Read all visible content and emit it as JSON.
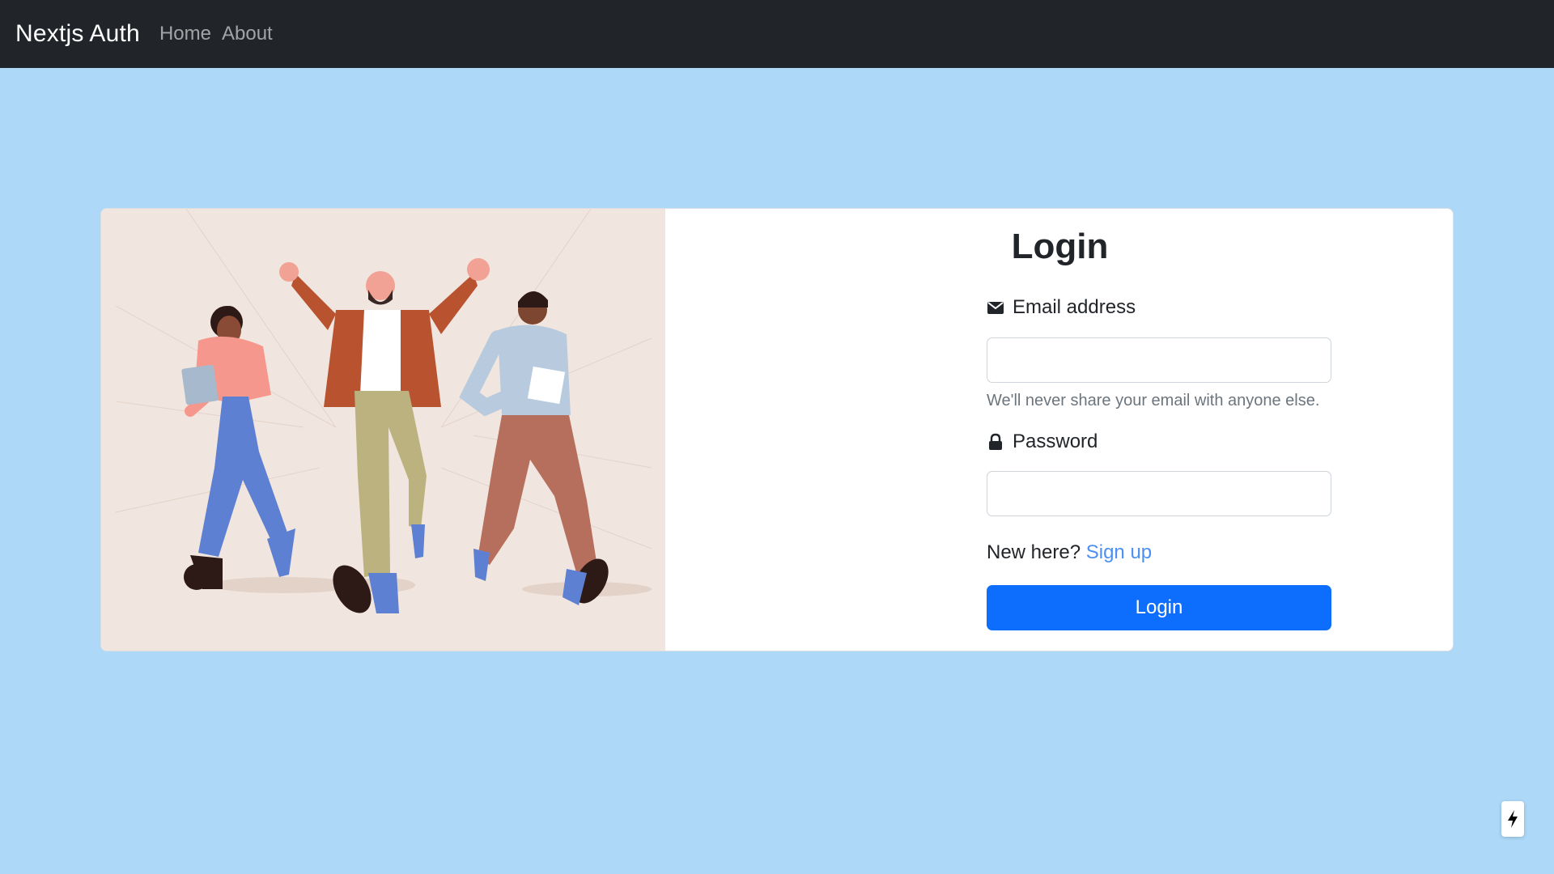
{
  "navbar": {
    "brand": "Nextjs Auth",
    "links": [
      "Home",
      "About"
    ]
  },
  "login_form": {
    "title": "Login",
    "email_label": "Email address",
    "email_value": "",
    "email_help": "We'll never share your email with anyone else.",
    "password_label": "Password",
    "password_value": "",
    "signup_prompt": "New here?",
    "signup_link": "Sign up",
    "submit_label": "Login"
  },
  "icons": {
    "email": "envelope-icon",
    "password": "lock-icon",
    "badge": "lightning-bolt-icon"
  },
  "colors": {
    "page_background": "#add8f7",
    "navbar": "#212529",
    "primary_button": "#0d6efd",
    "link": "#4b8ff2",
    "illustration_background": "#f1e6df"
  }
}
